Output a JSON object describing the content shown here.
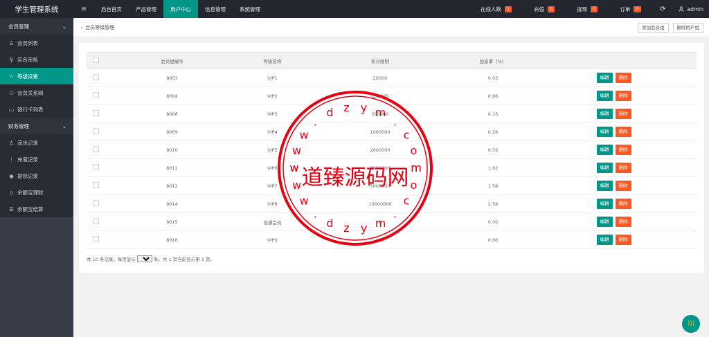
{
  "app": {
    "title": "学生管理系统"
  },
  "topnav": {
    "menu_icon": "≡",
    "items": [
      {
        "label": "后台首页"
      },
      {
        "label": "产品管理"
      },
      {
        "label": "用户中心"
      },
      {
        "label": "信息管理"
      },
      {
        "label": "系统管理"
      }
    ],
    "active_index": 2
  },
  "topright": {
    "online": {
      "label": "在线人数",
      "count": "1"
    },
    "recharge": {
      "label": "充值",
      "count": "0"
    },
    "withdraw": {
      "label": "提现",
      "count": "0"
    },
    "orders": {
      "label": "订单",
      "count": "0"
    },
    "refresh_icon": "refresh-icon",
    "user": "admin"
  },
  "sidebar": {
    "groups": [
      {
        "label": "会员管理",
        "items": [
          {
            "label": "会员列表",
            "icon": "user-icon"
          },
          {
            "label": "实名审核",
            "icon": "link-icon"
          },
          {
            "label": "等级设置",
            "icon": "star-icon"
          },
          {
            "label": "会员关系网",
            "icon": "users-icon"
          },
          {
            "label": "银行卡列表",
            "icon": "card-icon"
          }
        ]
      },
      {
        "label": "财务管理",
        "items": [
          {
            "label": "流水记录",
            "icon": "user-icon"
          },
          {
            "label": "充值记录",
            "icon": "info-icon"
          },
          {
            "label": "提现记录",
            "icon": "target-icon"
          },
          {
            "label": "余额宝理财",
            "icon": "diamond-icon"
          },
          {
            "label": "余额宝结算",
            "icon": "list-icon"
          }
        ]
      }
    ],
    "active": "等级设置"
  },
  "breadcrumb": {
    "sep": "»",
    "label": "会员等级管理"
  },
  "actions": {
    "add": "添加会员组",
    "delete": "删除用户组"
  },
  "table": {
    "headers": [
      "会员组编号",
      "等级名称",
      "积分限制",
      "加息率（%）"
    ],
    "edit_label": "编辑",
    "delete_label": "删除",
    "rows": [
      [
        "8003",
        "VIP1",
        "20000",
        "0.03"
      ],
      [
        "8004",
        "VIP2",
        "150000",
        "0.06"
      ],
      [
        "8008",
        "VIP3",
        "500000",
        "0.15"
      ],
      [
        "8009",
        "VIP4",
        "1000000",
        "0.26"
      ],
      [
        "8010",
        "VIP5",
        "2000000",
        "0.55"
      ],
      [
        "8011",
        "VIP6",
        "3000000",
        "1.02"
      ],
      [
        "8012",
        "VIP7",
        "5000000",
        "1.58"
      ],
      [
        "8014",
        "VIP8",
        "10000000",
        "2.58"
      ],
      [
        "8015",
        "普通会员",
        "0",
        "0.00"
      ],
      [
        "8016",
        "VIP0",
        "100",
        "0.00"
      ]
    ]
  },
  "pager": {
    "before": "共 10 条记录。每页显示",
    "value": "10",
    "after": "条。共 1 页当前显示第 1 页。"
  },
  "watermark": {
    "center": "道臻源码网",
    "ring": "www.dzym.com",
    "color": "#e60012"
  },
  "colors": {
    "accent": "#009688",
    "danger": "#ff5722",
    "dark": "#23262e",
    "side": "#393d49"
  }
}
